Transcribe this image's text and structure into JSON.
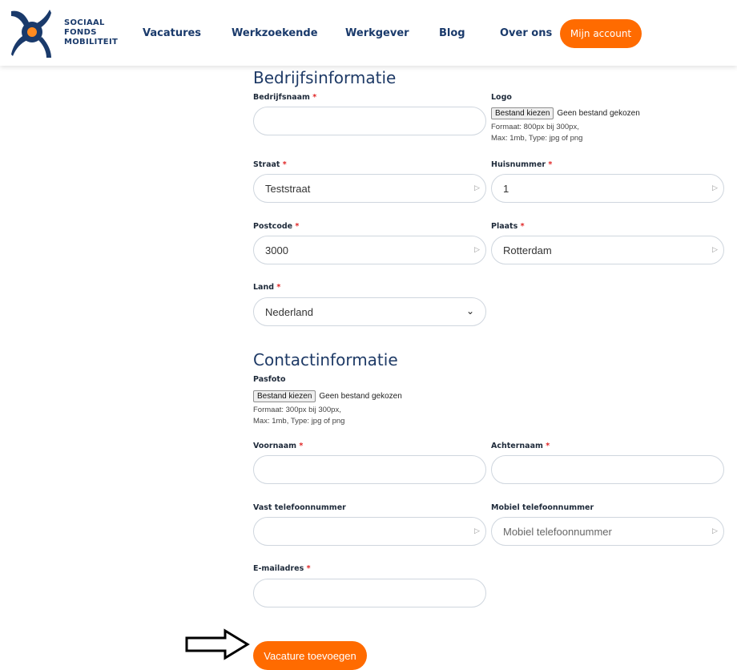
{
  "header": {
    "logo_lines": [
      "SOCIAAL",
      "FONDS",
      "MOBILITEIT"
    ],
    "nav": [
      "Vacatures",
      "Werkzoekende",
      "Werkgever",
      "Blog",
      "Over ons"
    ],
    "account_button": "Mijn account",
    "brand_colors": {
      "orange": "#ff6b00",
      "navy": "#1a3a6b"
    }
  },
  "company": {
    "title": "Bedrijfsinformatie",
    "bedrijfsnaam": {
      "label": "Bedrijfsnaam",
      "value": ""
    },
    "logo": {
      "label": "Logo",
      "button": "Bestand kiezen",
      "status": "Geen bestand gekozen",
      "hint1": "Formaat: 800px bij 300px,",
      "hint2": "Max: 1mb, Type: jpg of png"
    },
    "straat": {
      "label": "Straat",
      "value": "Teststraat"
    },
    "huisnummer": {
      "label": "Huisnummer",
      "value": "1"
    },
    "postcode": {
      "label": "Postcode",
      "value": "3000"
    },
    "plaats": {
      "label": "Plaats",
      "value": "Rotterdam"
    },
    "land": {
      "label": "Land",
      "value": "Nederland"
    }
  },
  "contact": {
    "title": "Contactinformatie",
    "pasfoto": {
      "label": "Pasfoto",
      "button": "Bestand kiezen",
      "status": "Geen bestand gekozen",
      "hint1": "Formaat: 300px bij 300px,",
      "hint2": "Max: 1mb, Type: jpg of png"
    },
    "voornaam": {
      "label": "Voornaam",
      "value": ""
    },
    "achternaam": {
      "label": "Achternaam",
      "value": ""
    },
    "vast_tel": {
      "label": "Vast telefoonnummer",
      "value": ""
    },
    "mobiel_tel": {
      "label": "Mobiel telefoonnummer",
      "placeholder": "Mobiel telefoonnummer"
    },
    "email": {
      "label": "E-mailadres",
      "value": ""
    }
  },
  "required_marker": "*",
  "submit_button": "Vacature toevoegen"
}
